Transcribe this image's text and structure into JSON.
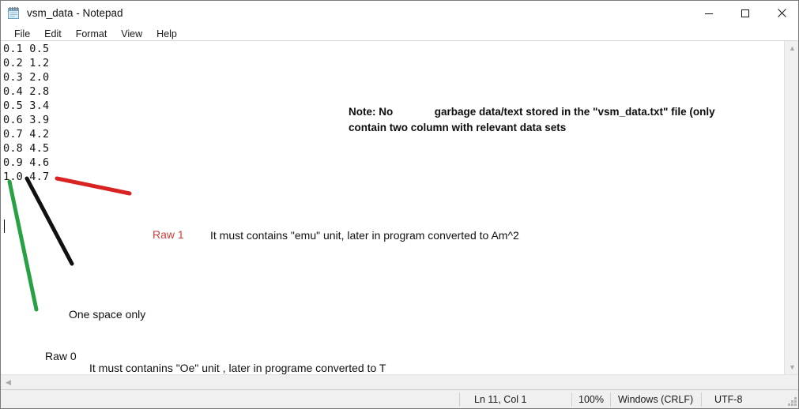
{
  "window": {
    "title": "vsm_data - Notepad",
    "icon": "notepad-icon",
    "controls": {
      "minimize": "minimize-icon",
      "maximize": "maximize-icon",
      "close": "close-icon"
    }
  },
  "menu": {
    "items": [
      {
        "label": "File"
      },
      {
        "label": "Edit"
      },
      {
        "label": "Format"
      },
      {
        "label": "View"
      },
      {
        "label": "Help"
      }
    ]
  },
  "editor": {
    "content": "0.1 0.5\n0.2 1.2\n0.3 2.0\n0.4 2.8\n0.5 3.4\n0.6 3.9\n0.7 4.2\n0.8 4.5\n0.9 4.6\n1.0 4.7",
    "rows": [
      {
        "col0": "0.1",
        "col1": "0.5"
      },
      {
        "col0": "0.2",
        "col1": "1.2"
      },
      {
        "col0": "0.3",
        "col1": "2.0"
      },
      {
        "col0": "0.4",
        "col1": "2.8"
      },
      {
        "col0": "0.5",
        "col1": "3.4"
      },
      {
        "col0": "0.6",
        "col1": "3.9"
      },
      {
        "col0": "0.7",
        "col1": "4.2"
      },
      {
        "col0": "0.8",
        "col1": "4.5"
      },
      {
        "col0": "0.9",
        "col1": "4.6"
      },
      {
        "col0": "1.0",
        "col1": "4.7"
      }
    ]
  },
  "annotations": {
    "note": "Note: No              garbage data/text stored in the \"vsm_data.txt\" file (only\ncontain two column with relevant data sets",
    "raw1_label": "Raw 1",
    "raw1_description": "It must contains \"emu\" unit, later in program converted to Am^2",
    "one_space_label": "One space only",
    "raw0_label": "Raw 0",
    "raw0_description": "It must contanins \"Oe\" unit , later in programe converted to T",
    "colors": {
      "red_marker": "#d92222",
      "green_marker": "#28a044",
      "black_marker": "#111111",
      "raw1_text": "#d03c3c"
    }
  },
  "scrollbars": {
    "vertical_up": "chevron-up-icon",
    "vertical_down": "chevron-down-icon",
    "horizontal_left": "chevron-left-icon"
  },
  "statusbar": {
    "position": "Ln 11, Col 1",
    "zoom": "100%",
    "line_ending": "Windows (CRLF)",
    "encoding": "UTF-8"
  }
}
